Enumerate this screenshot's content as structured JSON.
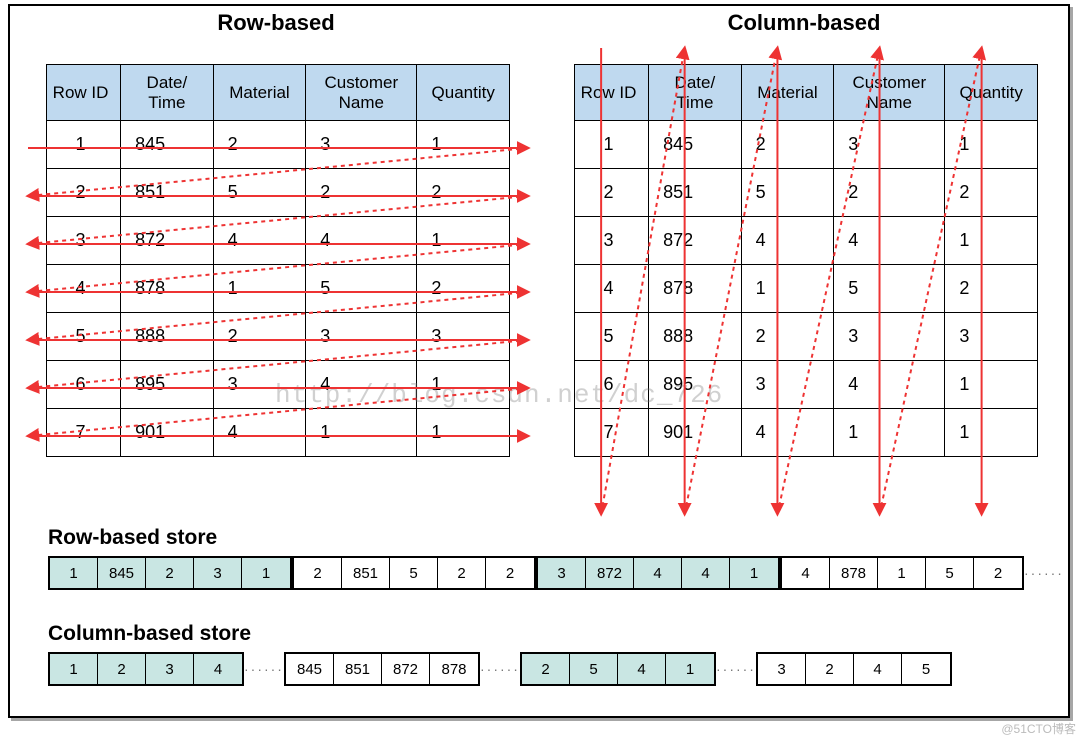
{
  "titles": {
    "left": "Row-based",
    "right": "Column-based"
  },
  "columns": [
    "Row ID",
    "Date/ Time",
    "Material",
    "Customer Name",
    "Quantity"
  ],
  "rows": [
    {
      "id": 1,
      "date": 845,
      "material": 2,
      "customer": 3,
      "qty": 1
    },
    {
      "id": 2,
      "date": 851,
      "material": 5,
      "customer": 2,
      "qty": 2
    },
    {
      "id": 3,
      "date": 872,
      "material": 4,
      "customer": 4,
      "qty": 1
    },
    {
      "id": 4,
      "date": 878,
      "material": 1,
      "customer": 5,
      "qty": 2
    },
    {
      "id": 5,
      "date": 888,
      "material": 2,
      "customer": 3,
      "qty": 3
    },
    {
      "id": 6,
      "date": 895,
      "material": 3,
      "customer": 4,
      "qty": 1
    },
    {
      "id": 7,
      "date": 901,
      "material": 4,
      "customer": 1,
      "qty": 1
    }
  ],
  "store_labels": {
    "row": "Row-based store",
    "col": "Column-based store"
  },
  "row_store": {
    "groups": [
      {
        "tint": true,
        "cells": [
          1,
          845,
          2,
          3,
          1
        ]
      },
      {
        "tint": false,
        "cells": [
          2,
          851,
          5,
          2,
          2
        ]
      },
      {
        "tint": true,
        "cells": [
          3,
          872,
          4,
          4,
          1
        ]
      },
      {
        "tint": false,
        "cells": [
          4,
          878,
          1,
          5,
          2
        ]
      }
    ],
    "trailing_dots": true
  },
  "col_store": {
    "groups": [
      {
        "tint": true,
        "cells": [
          1,
          2,
          3,
          4
        ]
      },
      {
        "tint": false,
        "cells": [
          845,
          851,
          872,
          878
        ]
      },
      {
        "tint": true,
        "cells": [
          2,
          5,
          4,
          1
        ]
      },
      {
        "tint": false,
        "cells": [
          3,
          2,
          4,
          5
        ]
      }
    ],
    "sep_dots": true
  },
  "watermark": "http://blog.csdn.net/dc_726",
  "credit": "@51CTO博客"
}
